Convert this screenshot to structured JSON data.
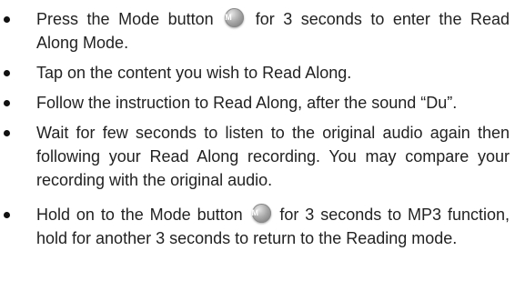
{
  "icons": {
    "mode_button_letter": "M"
  },
  "instructions": [
    {
      "before": "Press the Mode button ",
      "after": " for 3 seconds to enter the Read Along Mode."
    },
    {
      "text": "Tap on the content you wish to Read Along."
    },
    {
      "text": "Follow the instruction to Read Along, after the sound “Du”."
    },
    {
      "text": "Wait for few seconds to listen to the original audio again then following your Read Along recording. You may compare your recording with the original audio."
    },
    {
      "before": "Hold on to the Mode button ",
      "after": " for 3 seconds to MP3 function, hold for another 3 seconds to return to the Reading mode."
    }
  ]
}
